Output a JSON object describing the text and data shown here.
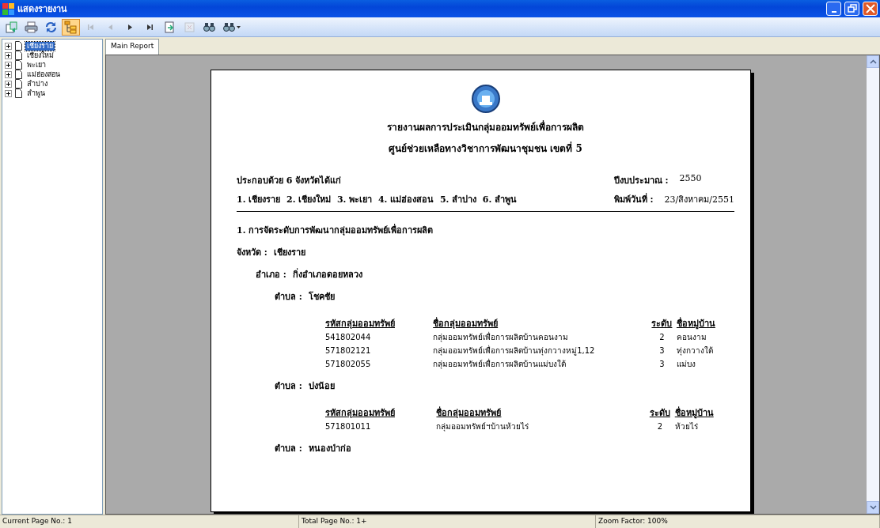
{
  "window": {
    "title": "แสดงรายงาน"
  },
  "toolbar": [
    {
      "kind": "export",
      "selected": false,
      "disabled": false
    },
    {
      "kind": "print",
      "selected": false,
      "disabled": false
    },
    {
      "kind": "refresh",
      "selected": false,
      "disabled": false
    },
    {
      "kind": "tree",
      "selected": true,
      "disabled": false
    },
    {
      "kind": "first",
      "selected": false,
      "disabled": true
    },
    {
      "kind": "prev",
      "selected": false,
      "disabled": true
    },
    {
      "kind": "next",
      "selected": false,
      "disabled": false
    },
    {
      "kind": "last",
      "selected": false,
      "disabled": false
    },
    {
      "kind": "goto",
      "selected": false,
      "disabled": false
    },
    {
      "kind": "stop",
      "selected": false,
      "disabled": true
    },
    {
      "kind": "search",
      "selected": false,
      "disabled": false
    },
    {
      "kind": "zoom",
      "selected": false,
      "disabled": false
    }
  ],
  "tree": {
    "items": [
      {
        "label": "เชียงราย",
        "selected": true,
        "expanded": false
      },
      {
        "label": "เชียงใหม่",
        "selected": false,
        "expanded": false
      },
      {
        "label": "พะเยา",
        "selected": false,
        "expanded": false
      },
      {
        "label": "แม่ฮ่องสอน",
        "selected": false,
        "expanded": false
      },
      {
        "label": "ลำปาง",
        "selected": false,
        "expanded": false
      },
      {
        "label": "ลำพูน",
        "selected": false,
        "expanded": false
      }
    ]
  },
  "tabs": [
    {
      "label": "Main Report",
      "selected": true
    }
  ],
  "report": {
    "title": "รายงานผลการประเมินกลุ่มออมทรัพย์เพื่อการผลิต",
    "subtitle": "ศูนย์ช่วยเหลือทางวิชาการพัฒนาชุมชน เขตที่ 5",
    "summary": "ประกอบด้วย 6 จังหวัดได้แก่",
    "provinces_line": "1. เชียงราย  2. เชียงใหม่  3. พะเยา  4. แม่ฮ่องสอน  5. ลำปาง  6. ลำพูน",
    "budget_year_label": "ปีงบประมาณ :",
    "budget_year": "2550",
    "print_date_label": "พิมพ์วันที่ :",
    "print_date": "23/สิงหาคม/2551",
    "section": "1. การจัดระดับการพัฒนากลุ่มออมทรัพย์เพื่อการผลิต",
    "province_label": "จังหวัด :",
    "province": "เชียงราย",
    "district_label": "อำเภอ :",
    "district": "กิ่งอำเภอดอยหลวง",
    "subdistricts": [
      {
        "label": "ตำบล :",
        "name": "โชคชัย",
        "columns": [
          "รหัสกลุ่มออมทรัพย์",
          "ชื่อกลุ่มออมทรัพย์",
          "ระดับ",
          "ชื่อหมู่บ้าน"
        ],
        "rows": [
          [
            "541802044",
            "กลุ่มออมทรัพย์เพื่อการผลิตบ้านคอนงาม",
            "2",
            "คอนงาม"
          ],
          [
            "571802121",
            "กลุ่มออมทรัพย์เพื่อการผลิตบ้านทุ่งกวางหมู่1,12",
            "3",
            "ทุ่งกวางใต้"
          ],
          [
            "571802055",
            "กลุ่มออมทรัพย์เพื่อการผลิตบ้านแม่บงใต้",
            "3",
            "แม่บง"
          ]
        ]
      },
      {
        "label": "ตำบล :",
        "name": "ปงน้อย",
        "columns": [
          "รหัสกลุ่มออมทรัพย์",
          "ชื่อกลุ่มออมทรัพย์",
          "ระดับ",
          "ชื่อหมู่บ้าน"
        ],
        "rows": [
          [
            "571801011",
            "กลุ่มออมทรัพย์ฯบ้านห้วยไร่",
            "2",
            "ห้วยไร่"
          ]
        ]
      },
      {
        "label": "ตำบล :",
        "name": "หนองป่าก่อ"
      }
    ]
  },
  "status_bar": [
    "Current Page No.: 1",
    "Total Page No.: 1+",
    "Zoom Factor: 100%"
  ]
}
